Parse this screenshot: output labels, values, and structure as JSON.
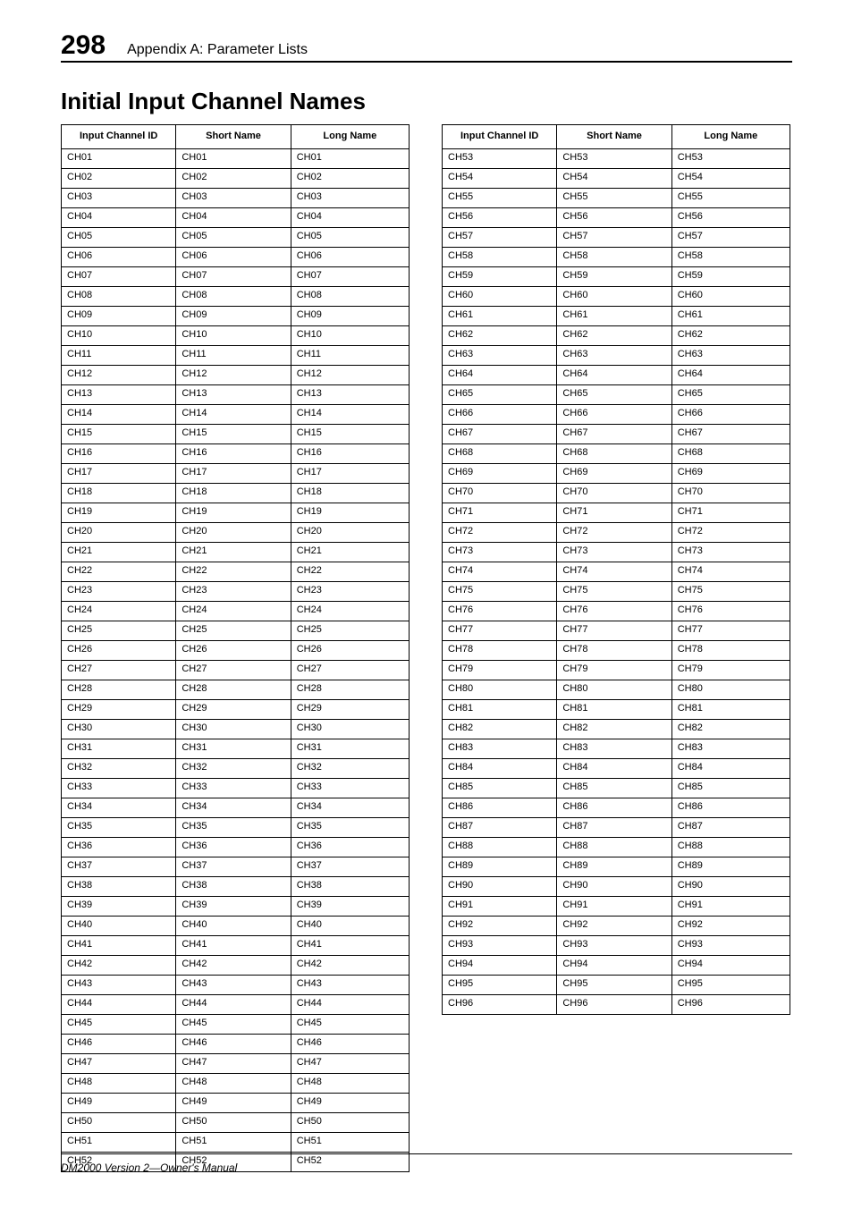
{
  "page_number": "298",
  "header_title": "Appendix A: Parameter Lists",
  "section_title": "Initial Input Channel Names",
  "footer": "DM2000 Version 2—Owner's Manual",
  "column_headers": {
    "id": "Input Channel ID",
    "short": "Short Name",
    "long": "Long Name"
  },
  "chart_data": {
    "type": "table",
    "columns": [
      "Input Channel ID",
      "Short Name",
      "Long Name"
    ],
    "rows_left": [
      {
        "id": "CH01",
        "short": "CH01",
        "long": "CH01"
      },
      {
        "id": "CH02",
        "short": "CH02",
        "long": "CH02"
      },
      {
        "id": "CH03",
        "short": "CH03",
        "long": "CH03"
      },
      {
        "id": "CH04",
        "short": "CH04",
        "long": "CH04"
      },
      {
        "id": "CH05",
        "short": "CH05",
        "long": "CH05"
      },
      {
        "id": "CH06",
        "short": "CH06",
        "long": "CH06"
      },
      {
        "id": "CH07",
        "short": "CH07",
        "long": "CH07"
      },
      {
        "id": "CH08",
        "short": "CH08",
        "long": "CH08"
      },
      {
        "id": "CH09",
        "short": "CH09",
        "long": "CH09"
      },
      {
        "id": "CH10",
        "short": "CH10",
        "long": "CH10"
      },
      {
        "id": "CH11",
        "short": "CH11",
        "long": "CH11"
      },
      {
        "id": "CH12",
        "short": "CH12",
        "long": "CH12"
      },
      {
        "id": "CH13",
        "short": "CH13",
        "long": "CH13"
      },
      {
        "id": "CH14",
        "short": "CH14",
        "long": "CH14"
      },
      {
        "id": "CH15",
        "short": "CH15",
        "long": "CH15"
      },
      {
        "id": "CH16",
        "short": "CH16",
        "long": "CH16"
      },
      {
        "id": "CH17",
        "short": "CH17",
        "long": "CH17"
      },
      {
        "id": "CH18",
        "short": "CH18",
        "long": "CH18"
      },
      {
        "id": "CH19",
        "short": "CH19",
        "long": "CH19"
      },
      {
        "id": "CH20",
        "short": "CH20",
        "long": "CH20"
      },
      {
        "id": "CH21",
        "short": "CH21",
        "long": "CH21"
      },
      {
        "id": "CH22",
        "short": "CH22",
        "long": "CH22"
      },
      {
        "id": "CH23",
        "short": "CH23",
        "long": "CH23"
      },
      {
        "id": "CH24",
        "short": "CH24",
        "long": "CH24"
      },
      {
        "id": "CH25",
        "short": "CH25",
        "long": "CH25"
      },
      {
        "id": "CH26",
        "short": "CH26",
        "long": "CH26"
      },
      {
        "id": "CH27",
        "short": "CH27",
        "long": "CH27"
      },
      {
        "id": "CH28",
        "short": "CH28",
        "long": "CH28"
      },
      {
        "id": "CH29",
        "short": "CH29",
        "long": "CH29"
      },
      {
        "id": "CH30",
        "short": "CH30",
        "long": "CH30"
      },
      {
        "id": "CH31",
        "short": "CH31",
        "long": "CH31"
      },
      {
        "id": "CH32",
        "short": "CH32",
        "long": "CH32"
      },
      {
        "id": "CH33",
        "short": "CH33",
        "long": "CH33"
      },
      {
        "id": "CH34",
        "short": "CH34",
        "long": "CH34"
      },
      {
        "id": "CH35",
        "short": "CH35",
        "long": "CH35"
      },
      {
        "id": "CH36",
        "short": "CH36",
        "long": "CH36"
      },
      {
        "id": "CH37",
        "short": "CH37",
        "long": "CH37"
      },
      {
        "id": "CH38",
        "short": "CH38",
        "long": "CH38"
      },
      {
        "id": "CH39",
        "short": "CH39",
        "long": "CH39"
      },
      {
        "id": "CH40",
        "short": "CH40",
        "long": "CH40"
      },
      {
        "id": "CH41",
        "short": "CH41",
        "long": "CH41"
      },
      {
        "id": "CH42",
        "short": "CH42",
        "long": "CH42"
      },
      {
        "id": "CH43",
        "short": "CH43",
        "long": "CH43"
      },
      {
        "id": "CH44",
        "short": "CH44",
        "long": "CH44"
      },
      {
        "id": "CH45",
        "short": "CH45",
        "long": "CH45"
      },
      {
        "id": "CH46",
        "short": "CH46",
        "long": "CH46"
      },
      {
        "id": "CH47",
        "short": "CH47",
        "long": "CH47"
      },
      {
        "id": "CH48",
        "short": "CH48",
        "long": "CH48"
      },
      {
        "id": "CH49",
        "short": "CH49",
        "long": "CH49"
      },
      {
        "id": "CH50",
        "short": "CH50",
        "long": "CH50"
      },
      {
        "id": "CH51",
        "short": "CH51",
        "long": "CH51"
      },
      {
        "id": "CH52",
        "short": "CH52",
        "long": "CH52"
      }
    ],
    "rows_right": [
      {
        "id": "CH53",
        "short": "CH53",
        "long": "CH53"
      },
      {
        "id": "CH54",
        "short": "CH54",
        "long": "CH54"
      },
      {
        "id": "CH55",
        "short": "CH55",
        "long": "CH55"
      },
      {
        "id": "CH56",
        "short": "CH56",
        "long": "CH56"
      },
      {
        "id": "CH57",
        "short": "CH57",
        "long": "CH57"
      },
      {
        "id": "CH58",
        "short": "CH58",
        "long": "CH58"
      },
      {
        "id": "CH59",
        "short": "CH59",
        "long": "CH59"
      },
      {
        "id": "CH60",
        "short": "CH60",
        "long": "CH60"
      },
      {
        "id": "CH61",
        "short": "CH61",
        "long": "CH61"
      },
      {
        "id": "CH62",
        "short": "CH62",
        "long": "CH62"
      },
      {
        "id": "CH63",
        "short": "CH63",
        "long": "CH63"
      },
      {
        "id": "CH64",
        "short": "CH64",
        "long": "CH64"
      },
      {
        "id": "CH65",
        "short": "CH65",
        "long": "CH65"
      },
      {
        "id": "CH66",
        "short": "CH66",
        "long": "CH66"
      },
      {
        "id": "CH67",
        "short": "CH67",
        "long": "CH67"
      },
      {
        "id": "CH68",
        "short": "CH68",
        "long": "CH68"
      },
      {
        "id": "CH69",
        "short": "CH69",
        "long": "CH69"
      },
      {
        "id": "CH70",
        "short": "CH70",
        "long": "CH70"
      },
      {
        "id": "CH71",
        "short": "CH71",
        "long": "CH71"
      },
      {
        "id": "CH72",
        "short": "CH72",
        "long": "CH72"
      },
      {
        "id": "CH73",
        "short": "CH73",
        "long": "CH73"
      },
      {
        "id": "CH74",
        "short": "CH74",
        "long": "CH74"
      },
      {
        "id": "CH75",
        "short": "CH75",
        "long": "CH75"
      },
      {
        "id": "CH76",
        "short": "CH76",
        "long": "CH76"
      },
      {
        "id": "CH77",
        "short": "CH77",
        "long": "CH77"
      },
      {
        "id": "CH78",
        "short": "CH78",
        "long": "CH78"
      },
      {
        "id": "CH79",
        "short": "CH79",
        "long": "CH79"
      },
      {
        "id": "CH80",
        "short": "CH80",
        "long": "CH80"
      },
      {
        "id": "CH81",
        "short": "CH81",
        "long": "CH81"
      },
      {
        "id": "CH82",
        "short": "CH82",
        "long": "CH82"
      },
      {
        "id": "CH83",
        "short": "CH83",
        "long": "CH83"
      },
      {
        "id": "CH84",
        "short": "CH84",
        "long": "CH84"
      },
      {
        "id": "CH85",
        "short": "CH85",
        "long": "CH85"
      },
      {
        "id": "CH86",
        "short": "CH86",
        "long": "CH86"
      },
      {
        "id": "CH87",
        "short": "CH87",
        "long": "CH87"
      },
      {
        "id": "CH88",
        "short": "CH88",
        "long": "CH88"
      },
      {
        "id": "CH89",
        "short": "CH89",
        "long": "CH89"
      },
      {
        "id": "CH90",
        "short": "CH90",
        "long": "CH90"
      },
      {
        "id": "CH91",
        "short": "CH91",
        "long": "CH91"
      },
      {
        "id": "CH92",
        "short": "CH92",
        "long": "CH92"
      },
      {
        "id": "CH93",
        "short": "CH93",
        "long": "CH93"
      },
      {
        "id": "CH94",
        "short": "CH94",
        "long": "CH94"
      },
      {
        "id": "CH95",
        "short": "CH95",
        "long": "CH95"
      },
      {
        "id": "CH96",
        "short": "CH96",
        "long": "CH96"
      }
    ]
  }
}
